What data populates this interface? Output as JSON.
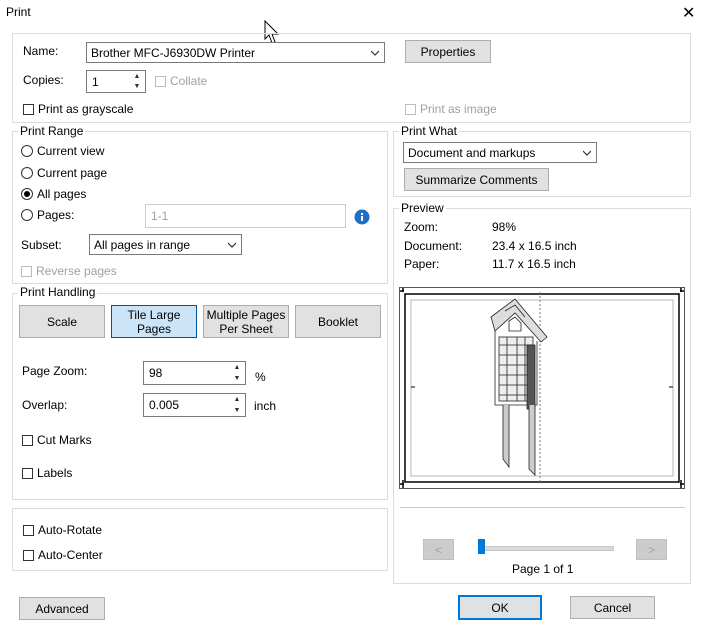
{
  "window": {
    "title": "Print",
    "close_glyph": "✕"
  },
  "printer": {
    "name_label": "Name:",
    "name_value": "Brother MFC-J6930DW Printer",
    "properties_label": "Properties",
    "copies_label": "Copies:",
    "copies_value": "1",
    "collate_label": "Collate",
    "grayscale_label": "Print as grayscale",
    "print_as_image_label": "Print as image"
  },
  "print_range": {
    "title": "Print Range",
    "current_view": "Current view",
    "current_page": "Current page",
    "all_pages": "All pages",
    "pages_label": "Pages:",
    "pages_value": "1-1",
    "subset_label": "Subset:",
    "subset_value": "All pages in range",
    "reverse_pages": "Reverse pages"
  },
  "print_what": {
    "title": "Print What",
    "value": "Document and markups",
    "summarize_label": "Summarize Comments"
  },
  "preview": {
    "title": "Preview",
    "zoom_label": "Zoom:",
    "zoom_value": "98%",
    "document_label": "Document:",
    "document_value": "23.4 x 16.5 inch",
    "paper_label": "Paper:",
    "paper_value": "11.7 x 16.5 inch",
    "page_indicator": "Page 1 of 1",
    "prev_glyph": "<",
    "next_glyph": ">"
  },
  "print_handling": {
    "title": "Print Handling",
    "scale": "Scale",
    "tile_line1": "Tile Large",
    "tile_line2": "Pages",
    "multiple_line1": "Multiple Pages",
    "multiple_line2": "Per Sheet",
    "booklet": "Booklet",
    "page_zoom_label": "Page Zoom:",
    "page_zoom_value": "98",
    "page_zoom_unit": "%",
    "overlap_label": "Overlap:",
    "overlap_value": "0.005",
    "overlap_unit": "inch",
    "cut_marks": "Cut Marks",
    "labels": "Labels"
  },
  "options": {
    "auto_rotate": "Auto-Rotate",
    "auto_center": "Auto-Center"
  },
  "footer": {
    "advanced": "Advanced",
    "ok": "OK",
    "cancel": "Cancel"
  },
  "colors": {
    "selected_bg": "#cce4f7",
    "primary_border": "#0078d7",
    "info_icon": "#1f6fc5"
  }
}
